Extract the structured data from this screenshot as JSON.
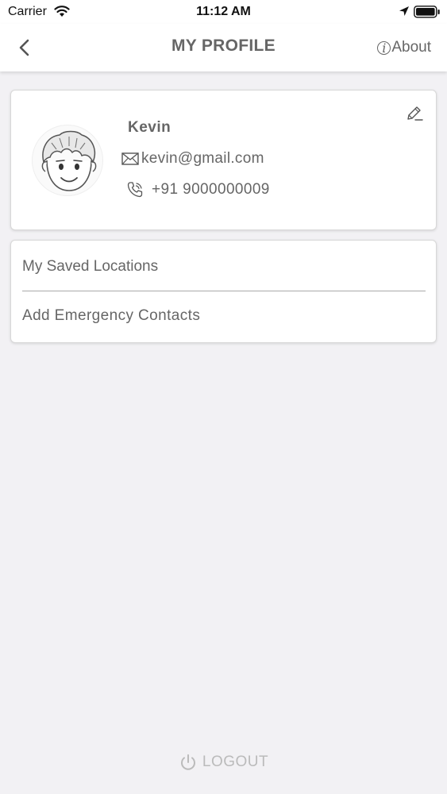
{
  "status_bar": {
    "carrier": "Carrier",
    "time": "11:12 AM",
    "icons": [
      "wifi-icon",
      "location-arrow-icon",
      "battery-icon"
    ]
  },
  "nav": {
    "title": "MY PROFILE",
    "about_label": "About",
    "about_icon": "i",
    "icons": [
      "back-chevron-icon",
      "info-icon"
    ]
  },
  "profile": {
    "name": "Kevin",
    "email": "kevin@gmail.com",
    "phone": "+91 9000000009",
    "icons": [
      "avatar",
      "edit-pencil-icon",
      "mail-icon",
      "phone-icon"
    ]
  },
  "menu": {
    "items": [
      {
        "label": "My Saved Locations"
      },
      {
        "label": "Add Emergency Contacts"
      }
    ]
  },
  "logout": {
    "label": "LOGOUT",
    "icon": "power-icon"
  },
  "colors": {
    "background": "#f2f1f4",
    "card": "#ffffff",
    "text": "#666666",
    "logout": "#bbbbbb"
  }
}
